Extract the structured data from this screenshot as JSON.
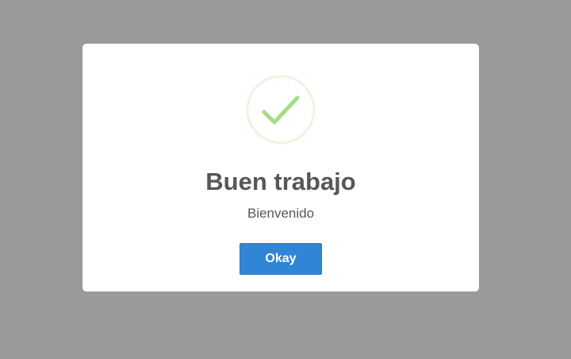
{
  "dialog": {
    "icon": "success-checkmark-icon",
    "title": "Buen trabajo",
    "text": "Bienvenido",
    "confirm_label": "Okay"
  },
  "colors": {
    "backdrop": "#999999",
    "modal_bg": "#ffffff",
    "title_text": "#575757",
    "success_ring": "#e8f5de",
    "success_check": "#a5dc86",
    "button_bg": "#3085d6",
    "button_text": "#ffffff"
  }
}
